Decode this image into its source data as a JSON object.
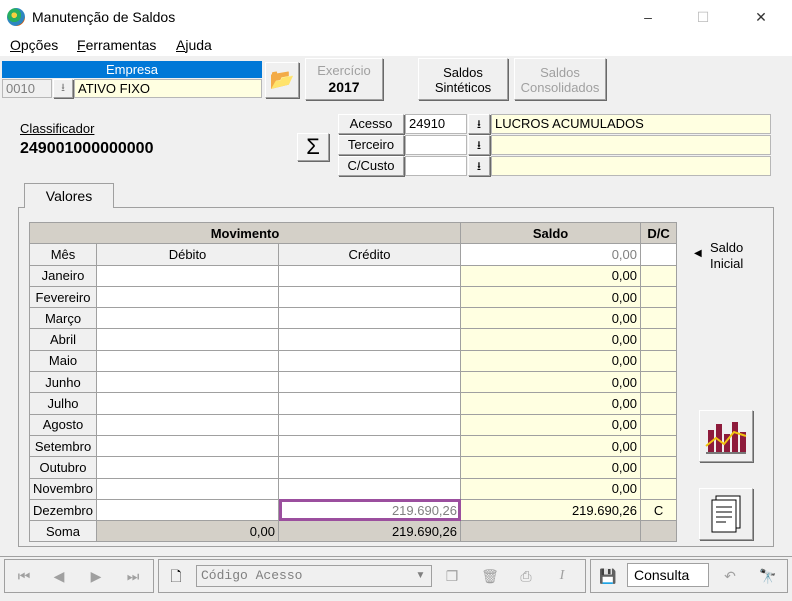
{
  "window": {
    "title": "Manutenção de Saldos",
    "minimize": "–",
    "maximize": "☐",
    "close": "✕"
  },
  "menu": [
    {
      "label": "Opções",
      "key": "O",
      "rest": "pções"
    },
    {
      "label": "Ferramentas",
      "key": "F",
      "rest": "erramentas"
    },
    {
      "label": "Ajuda",
      "key": "A",
      "rest": "juda"
    }
  ],
  "empresa": {
    "label": "Empresa",
    "code": "0010",
    "name": "ATIVO FIXO"
  },
  "exercicio": {
    "label": "Exercício",
    "value": "2017"
  },
  "buttons": {
    "saldos_sinteticos": [
      "Saldos",
      "Sintéticos"
    ],
    "saldos_consolidados": [
      "Saldos",
      "Consolidados"
    ],
    "saldo_inicial": [
      "Saldo",
      "Inicial"
    ]
  },
  "classificador": {
    "label": "Classificador",
    "value": "249001000000000"
  },
  "acesso": {
    "label": "Acesso",
    "value": "24910",
    "desc": "LUCROS ACUMULADOS"
  },
  "terceiro": {
    "label": "Terceiro",
    "value": "",
    "desc": ""
  },
  "custo": {
    "label": "C/Custo",
    "value": "",
    "desc": ""
  },
  "tab": {
    "label": "Valores"
  },
  "grid": {
    "group_movimento": "Movimento",
    "col_saldo": "Saldo",
    "col_dc": "D/C",
    "col_mes": "Mês",
    "col_debito": "Débito",
    "col_credito": "Crédito",
    "initial_saldo": "0,00",
    "rows": [
      {
        "mes": "Janeiro",
        "debito": "",
        "credito": "",
        "saldo": "0,00",
        "dc": ""
      },
      {
        "mes": "Fevereiro",
        "debito": "",
        "credito": "",
        "saldo": "0,00",
        "dc": ""
      },
      {
        "mes": "Março",
        "debito": "",
        "credito": "",
        "saldo": "0,00",
        "dc": ""
      },
      {
        "mes": "Abril",
        "debito": "",
        "credito": "",
        "saldo": "0,00",
        "dc": ""
      },
      {
        "mes": "Maio",
        "debito": "",
        "credito": "",
        "saldo": "0,00",
        "dc": ""
      },
      {
        "mes": "Junho",
        "debito": "",
        "credito": "",
        "saldo": "0,00",
        "dc": ""
      },
      {
        "mes": "Julho",
        "debito": "",
        "credito": "",
        "saldo": "0,00",
        "dc": ""
      },
      {
        "mes": "Agosto",
        "debito": "",
        "credito": "",
        "saldo": "0,00",
        "dc": ""
      },
      {
        "mes": "Setembro",
        "debito": "",
        "credito": "",
        "saldo": "0,00",
        "dc": ""
      },
      {
        "mes": "Outubro",
        "debito": "",
        "credito": "",
        "saldo": "0,00",
        "dc": ""
      },
      {
        "mes": "Novembro",
        "debito": "",
        "credito": "",
        "saldo": "0,00",
        "dc": ""
      },
      {
        "mes": "Dezembro",
        "debito": "",
        "credito": "219.690,26",
        "saldo": "219.690,26",
        "dc": "C"
      }
    ],
    "soma": {
      "label": "Soma",
      "debito": "0,00",
      "credito": "219.690,26"
    }
  },
  "statusbar": {
    "codigo_placeholder": "Código Acesso",
    "mode": "Consulta"
  }
}
